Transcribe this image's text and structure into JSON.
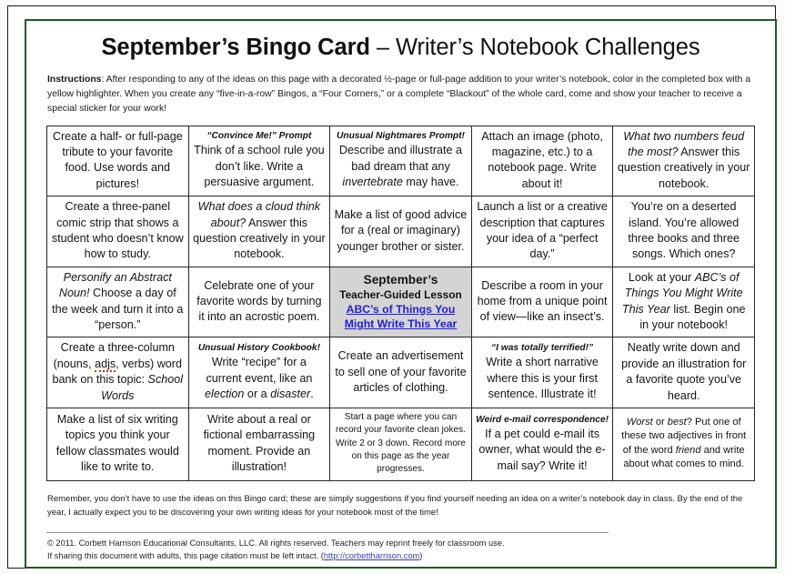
{
  "document": {
    "title_bold": "September’s Bingo Card",
    "title_sep": " – ",
    "title_regular": "Writer’s Notebook Challenges",
    "instructions_label": "Instructions",
    "instructions_text": ":  After responding to any of the ideas on this page with a decorated ½-page or full-page addition to your writer’s notebook,  color in the completed box with a yellow highlighter.  When you create any “five-in-a-row” Bingos, a “Four Corners,” or a complete “Blackout” of the whole card, come and show your teacher to receive a special sticker for your work!",
    "remember_text": "Remember, you don’t have to use the ideas on this Bingo card; these are simply suggestions if you find yourself needing an idea on a writer’s notebook day in class.  By the end of the year, I actually expect you to be discovering your own writing ideas for your notebook most of the time!",
    "copyright_line1": "© 2011.  Corbett Harrison Educational Consultants, LLC.  All rights reserved.   Teachers may reprint freely for classroom use.",
    "copyright_line2_pre": "If sharing this document with adults, this page citation must be left intact.  (",
    "copyright_link": "http://corbettharrison.com",
    "copyright_line2_post": ")"
  },
  "colors": {
    "page_border_green": "#1c5c22",
    "free_space_background": "#d4d4d4",
    "link_blue": "#2222cc",
    "spellcheck_red": "#c0392b"
  },
  "grid": {
    "rows": 5,
    "columns": 5,
    "cells": [
      [
        {
          "header": "",
          "body": "Create a half- or full-page tribute to your favorite food.  Use words and pictures!",
          "size": "big"
        },
        {
          "header": "“Convince Me!” Prompt",
          "body": "Think of a school rule you don’t like.  Write a persuasive argument.",
          "size": "big"
        },
        {
          "header": "Unusual Nightmares Prompt!",
          "body": "Describe and illustrate a bad dream that any invertebrate may have.",
          "size": "big",
          "italic_words": [
            "invertebrate"
          ]
        },
        {
          "header": "",
          "body": "Attach an image (photo, magazine, etc.) to a notebook page.  Write about it!",
          "size": "big"
        },
        {
          "header": "",
          "body": "What two numbers feud the most?  Answer this question creatively in your notebook.",
          "size": "big",
          "italic_words": [
            "What two numbers feud the most?"
          ]
        }
      ],
      [
        {
          "header": "",
          "body": "Create a three-panel comic strip that shows a student who doesn’t know how to study.",
          "size": "big"
        },
        {
          "header": "",
          "body": "What does a cloud think about?  Answer this question creatively in your notebook.",
          "size": "big",
          "italic_words": [
            "What does a cloud think about?"
          ]
        },
        {
          "header": "",
          "body": "Make a list of good advice for a (real or imaginary) younger brother or sister.",
          "size": "big"
        },
        {
          "header": "",
          "body": "Launch a list or a creative description that captures your idea of a “perfect day.”",
          "size": "big"
        },
        {
          "header": "",
          "body": "You’re on a deserted island.  You’re allowed three books and three songs.  Which ones?",
          "size": "big"
        }
      ],
      [
        {
          "header": "",
          "body": "Personify an Abstract Noun!  Choose a day of the week and turn it into a “person.”",
          "size": "big",
          "italic_words": [
            "Personify an Abstract Noun!"
          ]
        },
        {
          "header": "",
          "body": "Celebrate one of your favorite words by turning it into an acrostic poem.",
          "size": "big"
        },
        {
          "free_space": true,
          "line1": "September’s",
          "line2": "Teacher-Guided Lesson",
          "link": "ABC’s of Things You Might Write This Year"
        },
        {
          "header": "",
          "body": "Describe a room in your home from a unique point of view—like an insect’s.",
          "size": "big"
        },
        {
          "header": "",
          "body": "Look at your ABC’s of Things You Might Write This Year list. Begin one in your notebook!",
          "size": "big",
          "italic_words": [
            "ABC’s of Things You Might Write This Year"
          ]
        }
      ],
      [
        {
          "header": "",
          "body": "Create a three-column (nouns, adjs, verbs) word bank on this topic: School Words",
          "size": "big",
          "italic_words": [
            "School Words"
          ],
          "spellcheck_words": [
            "adjs"
          ]
        },
        {
          "header": "Unusual History Cookbook!",
          "body": "Write “recipe” for a current event, like an election or a disaster.",
          "size": "big",
          "italic_words": [
            "election",
            "disaster"
          ]
        },
        {
          "header": "",
          "body": "Create an advertisement to sell one of your favorite articles of clothing.",
          "size": "big"
        },
        {
          "header": "“I was totally terrified!”",
          "body": "Write a short narrative where this is your first sentence.  Illustrate it!",
          "size": "big"
        },
        {
          "header": "",
          "body": "Neatly write down and provide an illustration for a favorite quote you’ve heard.",
          "size": "big"
        }
      ],
      [
        {
          "header": "",
          "body": "Make a list of six writing topics you think your fellow classmates would like to write to.",
          "size": "big"
        },
        {
          "header": "",
          "body": "Write about a real or fictional embarrassing moment.  Provide an illustration!",
          "size": "big"
        },
        {
          "header": "",
          "body": "Start a page where you can record your favorite clean jokes.  Write 2 or 3 down. Record more on this page as the year progresses.",
          "size": "xsmall"
        },
        {
          "header": "Weird e-mail correspondence!",
          "body": "If a pet could e-mail its owner, what would the e-mail say?  Write it!",
          "size": "big"
        },
        {
          "header": "",
          "body": "Worst or best?  Put one of these two adjectives in front of the word friend and write about what comes to mind.",
          "size": "small",
          "italic_words": [
            "Worst",
            "best",
            "friend"
          ]
        }
      ]
    ]
  }
}
